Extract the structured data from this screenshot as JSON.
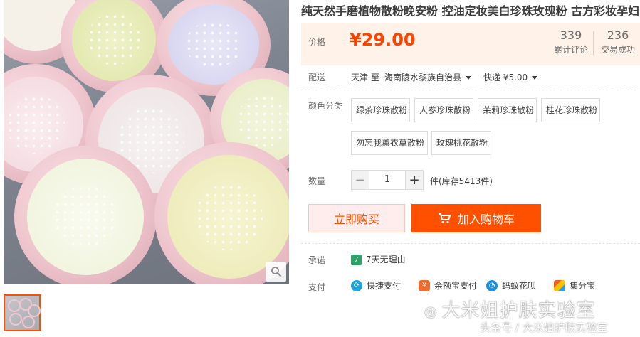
{
  "product": {
    "title": "纯天然手磨植物散粉晚安粉 控油定妆美白珍珠玫瑰粉 古方彩妆孕妇"
  },
  "price": {
    "label": "价格",
    "value": "¥29.00",
    "reviews_count": "339",
    "reviews_label": "累计评论",
    "sales_count": "236",
    "sales_label": "交易成功"
  },
  "shipping": {
    "label": "配送",
    "from": "天津",
    "to_word": "至",
    "destination": "海南陵水黎族自治县",
    "method": "快递 ¥5.00"
  },
  "color": {
    "label": "颜色分类",
    "options": [
      "绿茶珍珠散粉",
      "人参珍珠散粉",
      "茉莉珍珠散粉",
      "桂花珍珠散粉",
      "勿忘我薰衣草散粉",
      "玫瑰桃花散粉"
    ]
  },
  "quantity": {
    "label": "数量",
    "minus": "−",
    "value": "1",
    "plus": "+",
    "stock": "件(库存5413件)"
  },
  "actions": {
    "buy_now": "立即购买",
    "add_to_cart": "加入购物车"
  },
  "promise": {
    "label": "承诺",
    "badge": "7",
    "text": "7天无理由"
  },
  "payment": {
    "label": "支付",
    "methods": [
      "快捷支付",
      "余额宝支付",
      "蚂蚁花呗",
      "集分宝"
    ]
  },
  "watermark": {
    "line1": "大米姐护肤实验室",
    "line2": "头条号 / 大米姐护肤实验室"
  },
  "colors": {
    "accent": "#ff5000",
    "price": "#ff4400",
    "price_bg": "#fff2e8"
  }
}
